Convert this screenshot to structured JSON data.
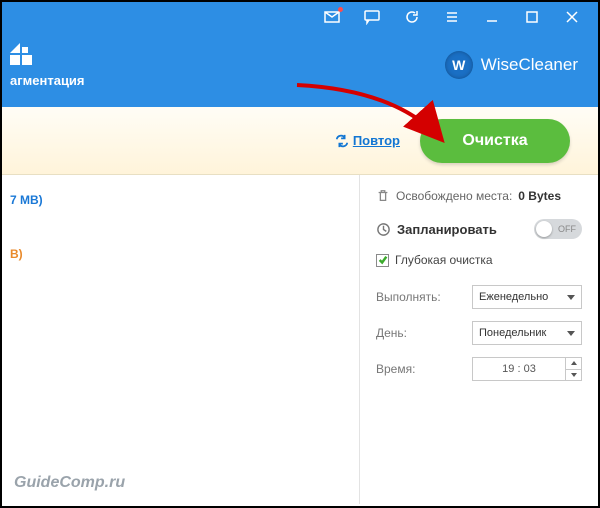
{
  "titlebar": {
    "icons": [
      "mail",
      "chat",
      "refresh",
      "menu",
      "minimize",
      "maximize",
      "close"
    ]
  },
  "header": {
    "tab_label": "агментация",
    "brand_letter": "W",
    "brand_name": "WiseCleaner"
  },
  "actionbar": {
    "repeat_label": "Повтор",
    "clean_label": "Очистка"
  },
  "left_panel": {
    "item1": "7 MB)",
    "item2": "B)"
  },
  "right_panel": {
    "freed_label": "Освобождено места:",
    "freed_value": "0 Bytes",
    "schedule_label": "Запланировать",
    "toggle_state": "OFF",
    "deep_clean_label": "Глубокая очистка",
    "run_label": "Выполнять:",
    "run_value": "Еженедельно",
    "day_label": "День:",
    "day_value": "Понедельник",
    "time_label": "Время:",
    "time_value": "19 : 03"
  },
  "watermark": "GuideComp.ru"
}
